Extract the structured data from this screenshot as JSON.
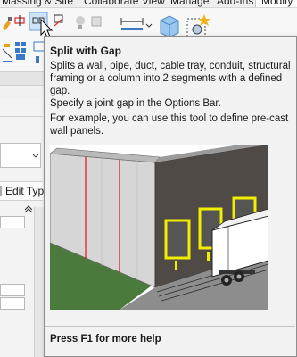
{
  "ribbon": {
    "tabs": [
      "Massing & Site",
      "Collaborate",
      "View",
      "Manage",
      "Add-Ins",
      "Modify"
    ]
  },
  "left_panel": {
    "edit_type_label": "Edit Type"
  },
  "tooltip": {
    "title": "Split with Gap",
    "description": "Splits a wall, pipe, duct, cable tray, conduit, structural framing or a column into 2 segments with a defined gap.",
    "paragraph2": "Specify a joint gap in the Options Bar.",
    "paragraph3": "For example, you can use this tool to define pre-cast wall panels.",
    "footer": "Press F1 for more help"
  },
  "colors": {
    "accent_red": "#e02020",
    "dock_yellow": "#f2ee00",
    "ground_green": "#4a7a3c"
  }
}
